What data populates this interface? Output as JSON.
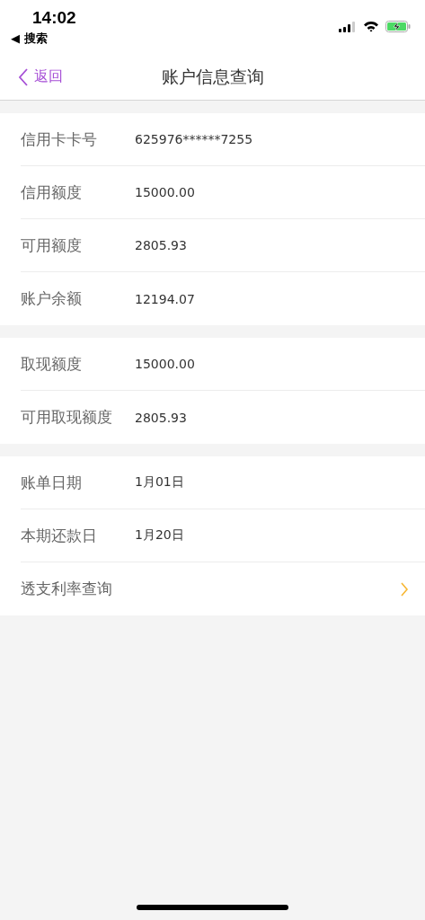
{
  "status_bar": {
    "time": "14:02",
    "back_app": "◀ 搜索"
  },
  "nav": {
    "back": "返回",
    "title": "账户信息查询"
  },
  "groups": [
    {
      "rows": [
        {
          "kind": "info",
          "label": "信用卡卡号",
          "value": "625976******7255"
        },
        {
          "kind": "info",
          "label": "信用额度",
          "value": "15000.00"
        },
        {
          "kind": "info",
          "label": "可用额度",
          "value": "2805.93"
        },
        {
          "kind": "info",
          "label": "账户余额",
          "value": "12194.07"
        }
      ]
    },
    {
      "rows": [
        {
          "kind": "info",
          "label": "取现额度",
          "value": "15000.00"
        },
        {
          "kind": "info",
          "label": "可用取现额度",
          "value": "2805.93"
        }
      ]
    },
    {
      "rows": [
        {
          "kind": "info",
          "label": "账单日期",
          "value": "1月01日"
        },
        {
          "kind": "info",
          "label": "本期还款日",
          "value": "1月20日"
        },
        {
          "kind": "link",
          "label": "透支利率查询"
        }
      ]
    }
  ]
}
